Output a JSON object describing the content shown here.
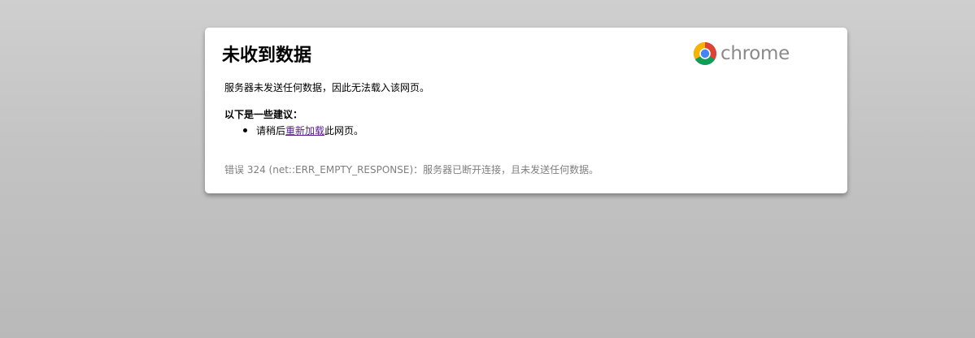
{
  "error_page": {
    "title": "未收到数据",
    "logo_text": "chrome",
    "summary": "服务器未发送任何数据，因此无法载入该网页。",
    "suggestions_heading": "以下是一些建议：",
    "suggestion": {
      "prefix": "请稍后",
      "link_text": "重新加载",
      "suffix": "此网页。"
    },
    "error_code": "错误 324 (net::ERR_EMPTY_RESPONSE)：服务器已断开连接，且未发送任何数据。"
  },
  "colors": {
    "link": "#551a8b",
    "error_text": "#7f7f7f",
    "logo_text": "#8a8a8a",
    "background": "#c3c3c3"
  },
  "icons": {
    "logo": "chrome-logo-icon"
  }
}
